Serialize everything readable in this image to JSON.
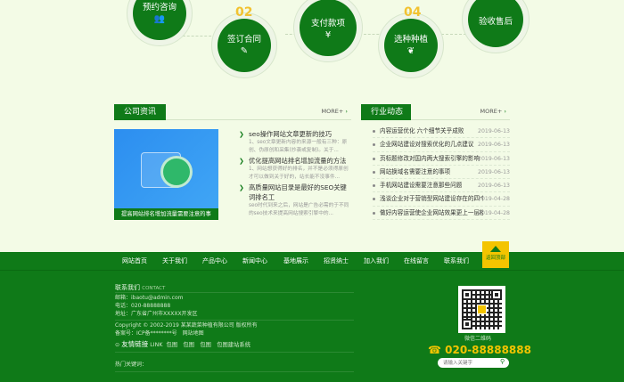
{
  "steps": [
    {
      "label": "预约咨询",
      "num": "",
      "icon": "people-icon",
      "glyph": "👥"
    },
    {
      "label": "签订合同",
      "num": "02",
      "icon": "edit-icon",
      "glyph": "✎"
    },
    {
      "label": "支付款项",
      "num": "",
      "icon": "money-icon",
      "glyph": "¥"
    },
    {
      "label": "选种种植",
      "num": "04",
      "icon": "sprout-icon",
      "glyph": "❦"
    },
    {
      "label": "验收售后",
      "num": "",
      "icon": "check-icon",
      "glyph": "✔"
    }
  ],
  "company": {
    "title": "公司资讯",
    "more": "MORE+",
    "featured_caption": "提高网站排名增加流量需要注意的事",
    "items": [
      {
        "title": "seo操作网站文章更新的技巧",
        "desc": "1、seo文章更新内容的来源一般有三种：原创、伪原创和采集(抄袭或复制)。关于..."
      },
      {
        "title": "优化提高网站排名增加流量的方法",
        "desc": "1、网站想获得好的排名，并不是必须得原创才可以做到关于好的，站长能不没事件..."
      },
      {
        "title": "高质量网站目录是最好的SEO关键词排名工",
        "desc": "seo时代到来之后，网站是广告必需的于不同的seo技术来提高网站搜索引擎中的..."
      }
    ]
  },
  "industry": {
    "title": "行业动态",
    "more": "MORE+",
    "items": [
      {
        "title": "内容运营优化 六个细节关乎成败",
        "date": "2019-06-13"
      },
      {
        "title": "企业网站建设对搜索优化的几点建议",
        "date": "2019-06-13"
      },
      {
        "title": "页标题修改对国内两大搜索引擎的影响",
        "date": "2019-06-13"
      },
      {
        "title": "网站换域名需要注意的事项",
        "date": "2019-06-13"
      },
      {
        "title": "手机网站建设需要注意那些问题",
        "date": "2019-06-13"
      },
      {
        "title": "浅谈企业对于营销型网站建设存在的四个",
        "date": "2019-04-28"
      },
      {
        "title": "做好内容运营使企业网站效果更上一层楼",
        "date": "2019-04-28"
      }
    ]
  },
  "nav": [
    "网站首页",
    "关于我们",
    "产品中心",
    "新闻中心",
    "基地展示",
    "招贤纳士",
    "加入我们",
    "在线留言",
    "联系我们"
  ],
  "totop": "返回顶部",
  "footer": {
    "contact_title": "联系我们",
    "contact_sub": "CONTACT",
    "email": "邮箱：ibaotu@admin.com",
    "tel": "电话：020-88888888",
    "address": "地址：广东省广州市XXXXX开发区",
    "copyright": "Copyright © 2002-2019 某某蔬菜种植有限公司 版权所有",
    "record": "备案号：ICP备********号　网站地图",
    "friend_label": "友情链接",
    "friend_sub": "LINK",
    "friend_links": "包图　包图　包图　包图建站系统",
    "keywords": "热门关键词：",
    "qr_label": "微信二维码",
    "phone": "020-88888888",
    "search_placeholder": "请输入关键字"
  }
}
